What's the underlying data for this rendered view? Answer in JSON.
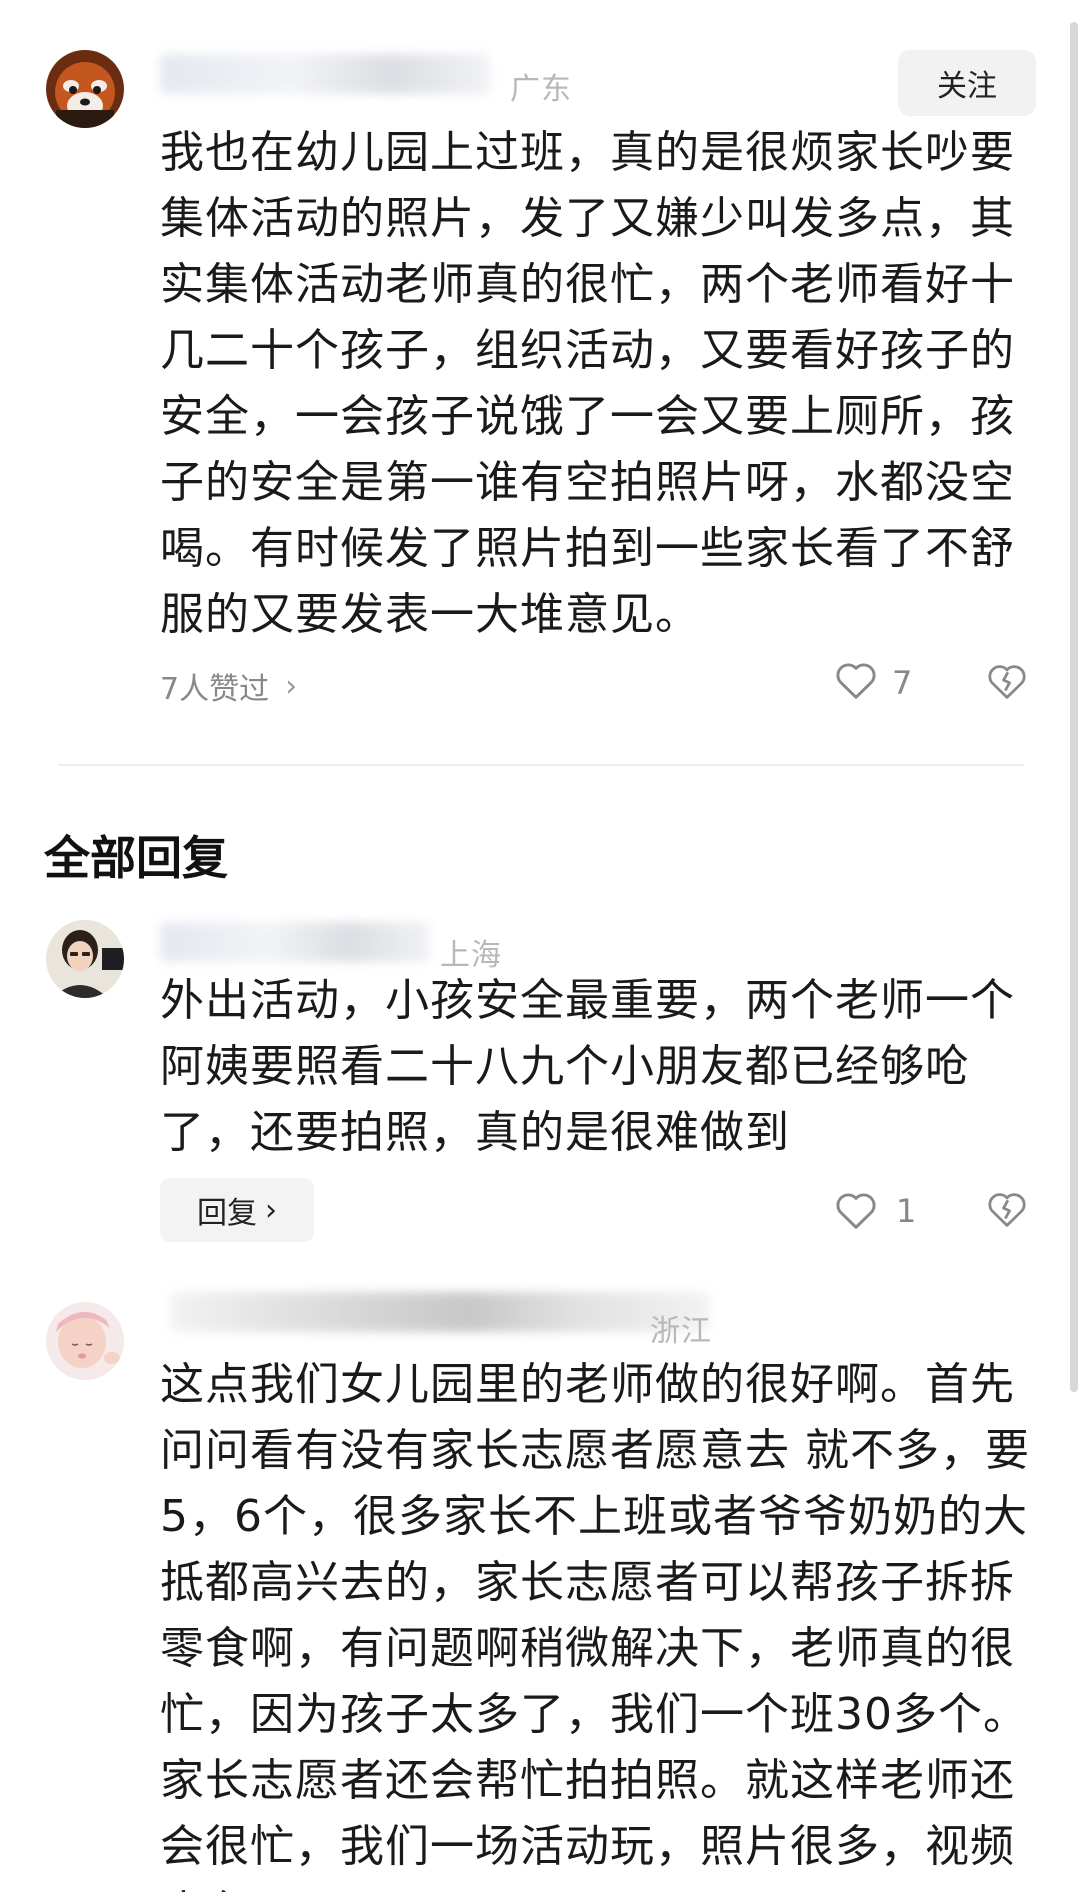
{
  "post": {
    "location": "广东",
    "follow_label": "关注",
    "text": "我也在幼儿园上过班，真的是很烦家长吵要\n集体活动的照片，发了又嫌少叫发多点，其\n实集体活动老师真的很忙，两个老师看好十\n几二十个孩子，组织活动，又要看好孩子的\n安全，一会孩子说饿了一会又要上厕所，孩\n子的安全是第一谁有空拍照片呀，水都没空\n喝。有时候发了照片拍到一些家长看了不舒\n服的又要发表一大堆意见。",
    "likers_label": "7人赞过",
    "like_count": "7"
  },
  "replies": {
    "section_title": "全部回复",
    "items": [
      {
        "location": "上海",
        "text": "外出活动，小孩安全最重要，两个老师一个\n阿姨要照看二十八九个小朋友都已经够呛\n了，还要拍照，真的是很难做到",
        "reply_label": "回复",
        "like_count": "1"
      },
      {
        "location": "浙江",
        "text": "这点我们女儿园里的老师做的很好啊。首先\n问问看有没有家长志愿者愿意去 就不多，要\n5，6个，很多家长不上班或者爷爷奶奶的大\n抵都高兴去的，家长志愿者可以帮孩子拆拆\n零食啊，有问题啊稍微解决下，老师真的很\n忙，因为孩子太多了，我们一个班30多个。\n家长志愿者还会帮忙拍拍照。就这样老师还\n会很忙，我们一场活动玩，照片很多，视频\n也有"
      }
    ]
  },
  "icons": {
    "chevron": "chevron-right-icon",
    "like": "heart-outline-icon",
    "dislike": "broken-heart-icon"
  }
}
